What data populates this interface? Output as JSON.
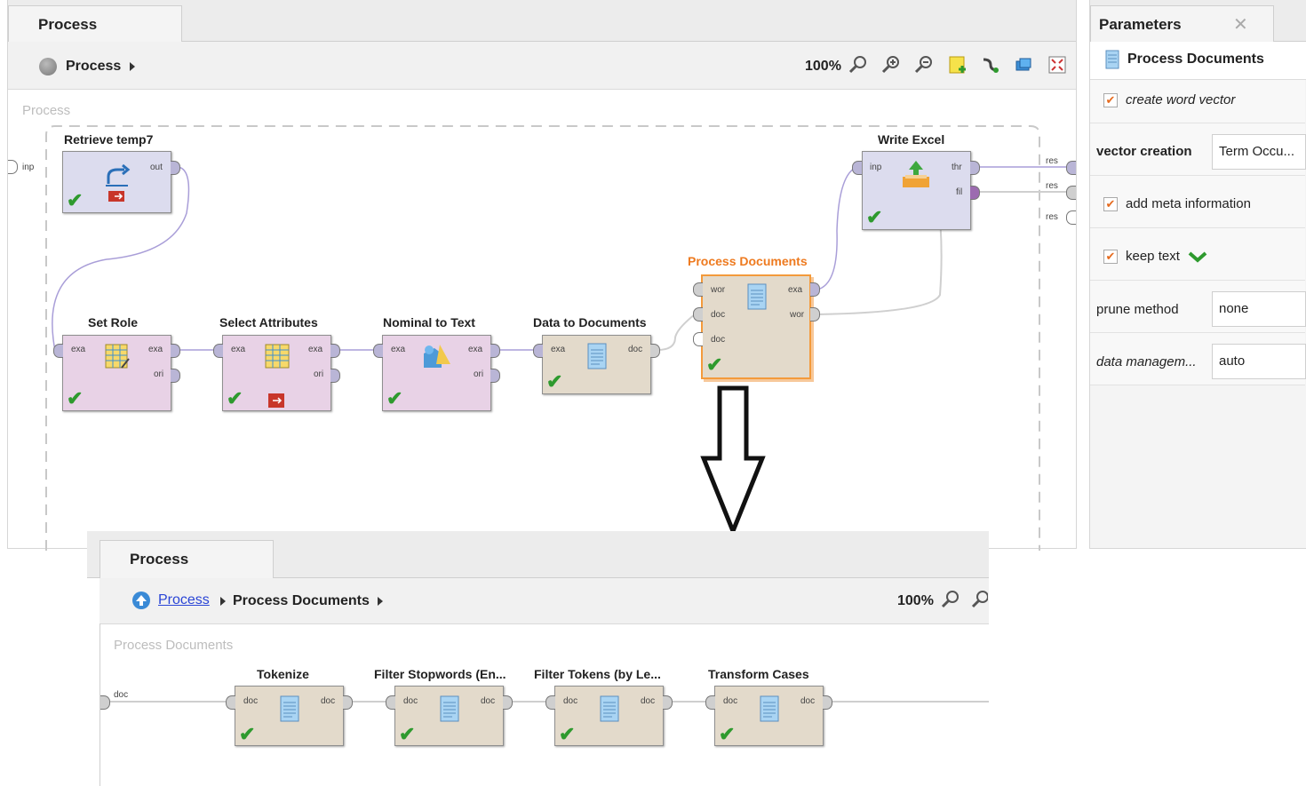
{
  "main": {
    "tab_label": "Process",
    "breadcrumb": "Process",
    "zoom": "100%",
    "canvas_label": "Process",
    "left_port_label": "inp",
    "right_port_labels": [
      "res",
      "res",
      "res"
    ]
  },
  "operators": {
    "retrieve": {
      "title": "Retrieve temp7",
      "ports_out": [
        "out"
      ]
    },
    "write_excel": {
      "title": "Write Excel",
      "ports_in": [
        "inp"
      ],
      "ports_out": [
        "thr",
        "fil"
      ]
    },
    "process_docs": {
      "title": "Process Documents",
      "ports_in": [
        "wor",
        "doc",
        "doc"
      ],
      "ports_out": [
        "exa",
        "wor"
      ]
    },
    "set_role": {
      "title": "Set Role",
      "ports_in": [
        "exa"
      ],
      "ports_out": [
        "exa",
        "ori"
      ]
    },
    "select_attr": {
      "title": "Select Attributes",
      "ports_in": [
        "exa"
      ],
      "ports_out": [
        "exa",
        "ori"
      ]
    },
    "nominal_text": {
      "title": "Nominal to Text",
      "ports_in": [
        "exa"
      ],
      "ports_out": [
        "exa",
        "ori"
      ]
    },
    "data_docs": {
      "title": "Data to Documents",
      "ports_in": [
        "exa"
      ],
      "ports_out": [
        "doc"
      ]
    }
  },
  "parameters": {
    "tab_label": "Parameters",
    "operator_name": "Process Documents",
    "rows": {
      "create_word_vector": "create word vector",
      "vector_creation_label": "vector creation",
      "vector_creation_value": "Term Occu...",
      "add_meta": "add meta information",
      "keep_text": "keep text",
      "prune_label": "prune method",
      "prune_value": "none",
      "data_mgmt_label": "data managem...",
      "data_mgmt_value": "auto"
    }
  },
  "sub": {
    "tab_label": "Process",
    "breadcrumb_link": "Process",
    "breadcrumb_current": "Process Documents",
    "zoom": "100%",
    "canvas_label": "Process Documents",
    "left_port_label": "doc",
    "operators": [
      {
        "title": "Tokenize",
        "in": "doc",
        "out": "doc"
      },
      {
        "title": "Filter Stopwords (En...",
        "in": "doc",
        "out": "doc"
      },
      {
        "title": "Filter Tokens (by Le...",
        "in": "doc",
        "out": "doc"
      },
      {
        "title": "Transform Cases",
        "in": "doc",
        "out": "doc"
      }
    ]
  },
  "icons": {
    "zoom": "magnifier-icon",
    "check": "check-icon",
    "document": "document-icon",
    "arrow": "down-arrow"
  },
  "colors": {
    "selected_operator": "#ee7a1f",
    "check": "#2e9a2e",
    "link": "#2a45d6"
  }
}
